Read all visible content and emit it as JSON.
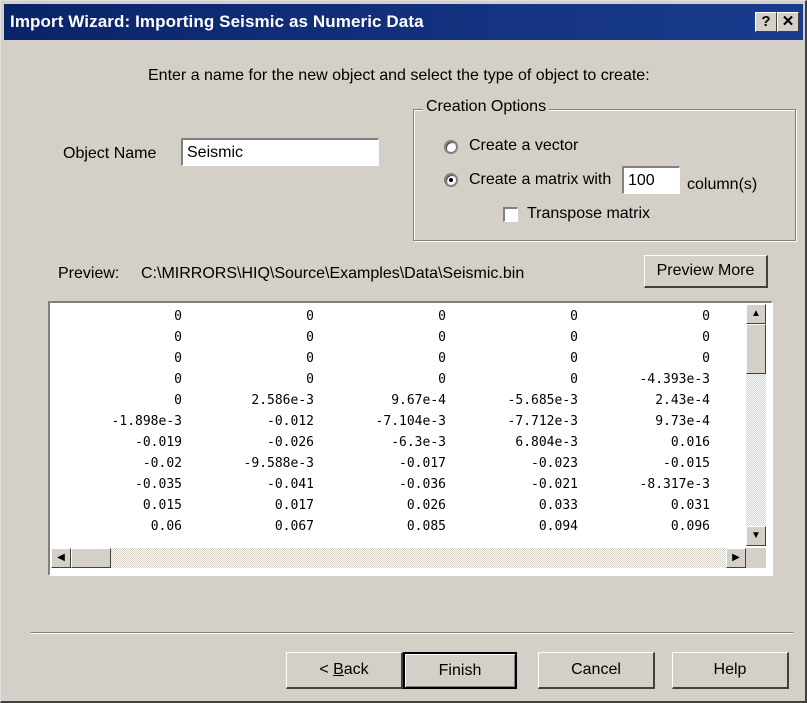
{
  "window": {
    "title": "Import Wizard: Importing Seismic as Numeric Data",
    "help_glyph": "?",
    "close_glyph": "✕"
  },
  "instructions": "Enter a name for the new object and select the type of object to create:",
  "object_name": {
    "label": "Object Name",
    "value": "Seismic"
  },
  "creation_options": {
    "title": "Creation Options",
    "vector_label": "Create a vector",
    "matrix_label": "Create a matrix with",
    "columns_value": "100",
    "columns_suffix": "column(s)",
    "transpose_label": "Transpose matrix",
    "selected": "matrix",
    "transpose_checked": false
  },
  "preview": {
    "label": "Preview:",
    "path": "C:\\MIRRORS\\HIQ\\Source\\Examples\\Data\\Seismic.bin",
    "more_button": "Preview More",
    "rows": [
      [
        "0",
        "0",
        "0",
        "0",
        "0"
      ],
      [
        "0",
        "0",
        "0",
        "0",
        "0"
      ],
      [
        "0",
        "0",
        "0",
        "0",
        "0"
      ],
      [
        "0",
        "0",
        "0",
        "0",
        "-4.393e-3"
      ],
      [
        "0",
        "2.586e-3",
        "9.67e-4",
        "-5.685e-3",
        "2.43e-4"
      ],
      [
        "-1.898e-3",
        "-0.012",
        "-7.104e-3",
        "-7.712e-3",
        "9.73e-4"
      ],
      [
        "-0.019",
        "-0.026",
        "-6.3e-3",
        "6.804e-3",
        "0.016"
      ],
      [
        "-0.02",
        "-9.588e-3",
        "-0.017",
        "-0.023",
        "-0.015"
      ],
      [
        "-0.035",
        "-0.041",
        "-0.036",
        "-0.021",
        "-8.317e-3"
      ],
      [
        "0.015",
        "0.017",
        "0.026",
        "0.033",
        "0.031"
      ],
      [
        "0.06",
        "0.067",
        "0.085",
        "0.094",
        "0.096"
      ]
    ]
  },
  "buttons": {
    "back_prefix": "< ",
    "back_mnemonic": "B",
    "back_rest": "ack",
    "finish": "Finish",
    "cancel": "Cancel",
    "help": "Help"
  },
  "scroll_glyphs": {
    "up": "▲",
    "down": "▼",
    "left": "◀",
    "right": "▶"
  }
}
